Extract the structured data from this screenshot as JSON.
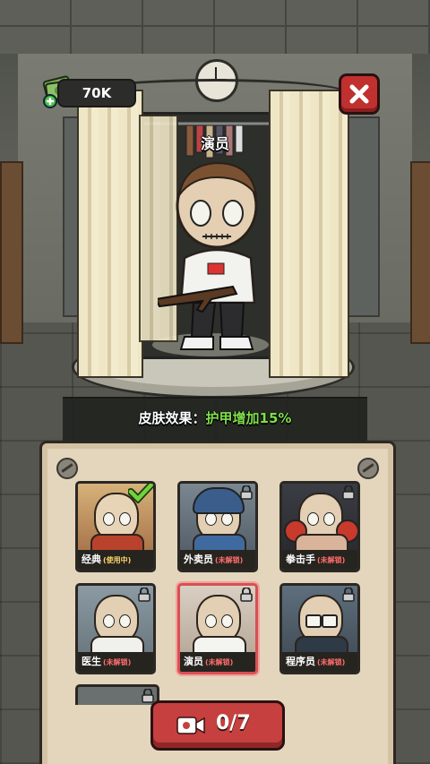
{
  "hud": {
    "currency": "70K",
    "icon": "cash-plus-icon",
    "close_icon": "close-icon"
  },
  "character": {
    "name": "演员"
  },
  "skin_effect": {
    "label": "皮肤效果：",
    "value": "护甲增加15%"
  },
  "skins": [
    {
      "name": "经典",
      "status": "(使用中)",
      "state": "in-use"
    },
    {
      "name": "外卖员",
      "status": "(未解锁)",
      "state": "locked"
    },
    {
      "name": "拳击手",
      "status": "(未解锁)",
      "state": "locked"
    },
    {
      "name": "医生",
      "status": "(未解锁)",
      "state": "locked"
    },
    {
      "name": "演员",
      "status": "(未解锁)",
      "state": "locked-selected"
    },
    {
      "name": "程序员",
      "status": "(未解锁)",
      "state": "locked"
    }
  ],
  "video_button": {
    "count": "0/7",
    "icon": "video-camera-icon"
  },
  "colors": {
    "effect_value": "#7fe04a",
    "locked_status": "#ff6d6d",
    "in_use_status": "#ffd56a",
    "button_red": "#c5403e"
  }
}
